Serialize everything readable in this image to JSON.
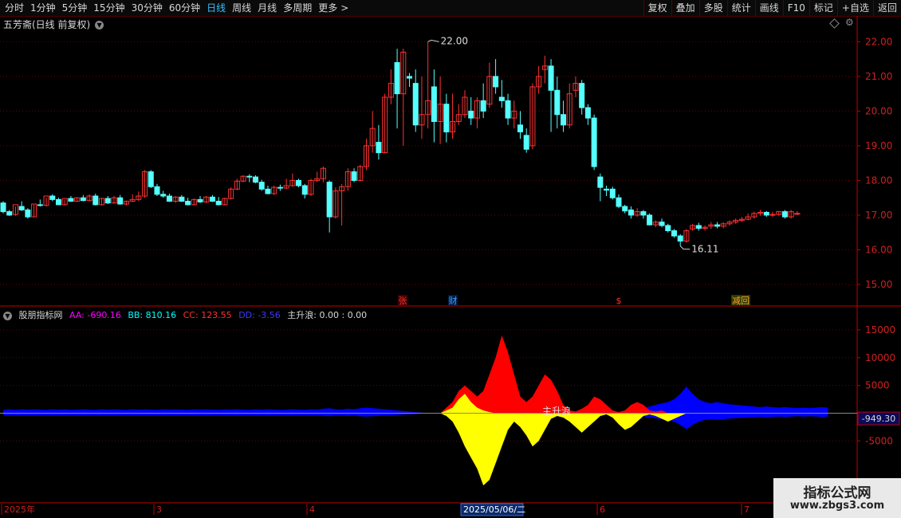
{
  "toolbar": {
    "periods": [
      "分时",
      "1分钟",
      "5分钟",
      "15分钟",
      "30分钟",
      "60分钟",
      "日线",
      "周线",
      "月线",
      "多周期",
      "更多"
    ],
    "active_period": "日线",
    "more_arrow": ">",
    "right_buttons": [
      "复权",
      "叠加",
      "多股",
      "统计",
      "画线",
      "F10",
      "标记",
      "+自选",
      "返回"
    ]
  },
  "main_chart": {
    "title": "五芳斋(日线 前复权)",
    "high_label": "22.00",
    "low_label": "16.11",
    "price_ticks": [
      "22.00",
      "21.00",
      "20.00",
      "19.00",
      "18.00",
      "17.00",
      "16.00",
      "15.00"
    ],
    "event_markers": [
      "张",
      "财",
      "$",
      "减回"
    ]
  },
  "indicator": {
    "name": "股朋指标网",
    "AA": "AA: -690.16",
    "BB": "BB: 810.16",
    "CC": "CC: 123.55",
    "DD": "DD: -3.56",
    "zsl": "主升浪: 0.00 : 0.00",
    "annotation": "主升浪",
    "ticks": [
      "15000",
      "10000",
      "5000",
      "-5000"
    ],
    "current_value": "-949.30"
  },
  "date_axis": {
    "labels": [
      "2025年",
      "3",
      "4",
      "2025/05/06/二",
      "6",
      "7"
    ]
  },
  "watermark": {
    "line1": "指标公式网",
    "line2": "www.zbgs3.com"
  },
  "colors": {
    "up": "#ff3232",
    "down": "#54ffff",
    "grid": "#6a0000",
    "aa": "#ff00ff",
    "bb": "#00ffff",
    "cc": "#ff3232",
    "dd": "#3a3aff",
    "yellow": "#ffff00",
    "red_area": "#ff0000",
    "blue_area": "#0000ff"
  },
  "chart_data": {
    "type": "candlestick",
    "ylim": [
      14.7,
      22.4
    ],
    "candles": [
      [
        17.35,
        17.4,
        17.1,
        17.05
      ],
      [
        17.1,
        17.15,
        17.0,
        16.98
      ],
      [
        17.02,
        17.25,
        17.3,
        16.98
      ],
      [
        17.25,
        17.4,
        17.15,
        17.12
      ],
      [
        17.15,
        17.2,
        16.95,
        16.9
      ],
      [
        16.95,
        17.3,
        17.32,
        16.95
      ],
      [
        17.3,
        17.45,
        17.28,
        17.25
      ],
      [
        17.28,
        17.5,
        17.55,
        17.25
      ],
      [
        17.55,
        17.6,
        17.45,
        17.4
      ],
      [
        17.45,
        17.5,
        17.3,
        17.3
      ],
      [
        17.3,
        17.45,
        17.48,
        17.28
      ],
      [
        17.48,
        17.55,
        17.4,
        17.38
      ],
      [
        17.4,
        17.52,
        17.5,
        17.38
      ],
      [
        17.5,
        17.58,
        17.42,
        17.4
      ],
      [
        17.42,
        17.6,
        17.55,
        17.4
      ],
      [
        17.55,
        17.62,
        17.3,
        17.28
      ],
      [
        17.3,
        17.5,
        17.48,
        17.28
      ],
      [
        17.48,
        17.55,
        17.35,
        17.32
      ],
      [
        17.35,
        17.55,
        17.5,
        17.33
      ],
      [
        17.5,
        17.58,
        17.32,
        17.3
      ],
      [
        17.32,
        17.42,
        17.4,
        17.28
      ],
      [
        17.4,
        17.6,
        17.45,
        17.38
      ],
      [
        17.45,
        17.68,
        17.55,
        17.4
      ],
      [
        17.55,
        18.3,
        18.25,
        17.5
      ],
      [
        18.25,
        18.3,
        17.82,
        17.78
      ],
      [
        17.82,
        17.9,
        17.6,
        17.55
      ],
      [
        17.6,
        17.7,
        17.55,
        17.5
      ],
      [
        17.55,
        17.62,
        17.4,
        17.38
      ],
      [
        17.4,
        17.55,
        17.52,
        17.35
      ],
      [
        17.52,
        17.58,
        17.4,
        17.38
      ],
      [
        17.4,
        17.5,
        17.3,
        17.28
      ],
      [
        17.3,
        17.48,
        17.45,
        17.28
      ],
      [
        17.45,
        17.55,
        17.38,
        17.35
      ],
      [
        17.38,
        17.55,
        17.52,
        17.35
      ],
      [
        17.52,
        17.58,
        17.4,
        17.38
      ],
      [
        17.4,
        17.52,
        17.3,
        17.28
      ],
      [
        17.3,
        17.5,
        17.48,
        17.28
      ],
      [
        17.48,
        17.8,
        17.75,
        17.45
      ],
      [
        17.75,
        18.05,
        17.98,
        17.72
      ],
      [
        17.98,
        18.15,
        18.12,
        17.95
      ],
      [
        18.12,
        18.18,
        18.1,
        17.95
      ],
      [
        18.1,
        18.15,
        17.95,
        17.92
      ],
      [
        17.95,
        18.02,
        17.75,
        17.7
      ],
      [
        17.75,
        17.85,
        17.62,
        17.6
      ],
      [
        17.62,
        17.85,
        17.8,
        17.58
      ],
      [
        17.8,
        17.88,
        17.78,
        17.7
      ],
      [
        17.78,
        18.05,
        17.85,
        17.75
      ],
      [
        17.85,
        18.2,
        18.0,
        17.82
      ],
      [
        18.0,
        18.05,
        17.85,
        17.8
      ],
      [
        17.85,
        17.9,
        17.6,
        17.48
      ],
      [
        17.6,
        18.05,
        18.0,
        17.55
      ],
      [
        18.0,
        18.25,
        18.05,
        17.95
      ],
      [
        18.05,
        18.4,
        18.35,
        17.95
      ],
      [
        17.95,
        18.0,
        16.95,
        16.5
      ],
      [
        16.95,
        17.8,
        17.7,
        16.9
      ],
      [
        17.7,
        17.9,
        17.82,
        16.7
      ],
      [
        17.82,
        18.35,
        18.25,
        17.7
      ],
      [
        18.25,
        18.35,
        18.0,
        17.95
      ],
      [
        18.0,
        18.45,
        18.4,
        17.98
      ],
      [
        18.4,
        19.2,
        19.0,
        18.3
      ],
      [
        19.0,
        20.0,
        19.5,
        18.8
      ],
      [
        19.1,
        19.6,
        18.8,
        18.6
      ],
      [
        18.8,
        20.5,
        20.4,
        18.8
      ],
      [
        20.4,
        21.2,
        20.8,
        20.2
      ],
      [
        21.4,
        21.8,
        20.5,
        19.5
      ],
      [
        20.5,
        21.8,
        21.7,
        19.0
      ],
      [
        21.0,
        21.1,
        20.95,
        20.7
      ],
      [
        20.8,
        21.2,
        19.6,
        19.4
      ],
      [
        19.6,
        21.0,
        19.9,
        19.2
      ],
      [
        19.9,
        22.0,
        20.3,
        19.5
      ],
      [
        20.7,
        21.2,
        19.7,
        19.1
      ],
      [
        19.7,
        21.0,
        20.2,
        19.05
      ],
      [
        20.2,
        20.5,
        19.4,
        19.1
      ],
      [
        19.4,
        20.5,
        19.7,
        19.2
      ],
      [
        19.7,
        20.2,
        19.9,
        19.6
      ],
      [
        19.9,
        20.6,
        20.4,
        19.8
      ],
      [
        20.0,
        20.4,
        19.8,
        19.6
      ],
      [
        19.8,
        20.4,
        20.3,
        19.5
      ],
      [
        20.3,
        20.8,
        20.0,
        19.8
      ],
      [
        20.2,
        21.4,
        21.0,
        20.1
      ],
      [
        21.0,
        21.5,
        20.7,
        20.5
      ],
      [
        20.4,
        20.9,
        20.3,
        20.1
      ],
      [
        20.3,
        20.5,
        19.8,
        19.6
      ],
      [
        19.8,
        20.3,
        20.0,
        19.5
      ],
      [
        19.6,
        20.0,
        19.4,
        19.2
      ],
      [
        19.3,
        19.5,
        18.9,
        18.8
      ],
      [
        19.0,
        20.8,
        20.7,
        18.9
      ],
      [
        20.7,
        21.3,
        21.0,
        20.5
      ],
      [
        21.2,
        21.6,
        21.3,
        20.8
      ],
      [
        21.3,
        21.5,
        20.6,
        19.4
      ],
      [
        20.6,
        21.0,
        19.9,
        19.5
      ],
      [
        19.9,
        20.3,
        19.6,
        19.4
      ],
      [
        19.6,
        20.8,
        20.5,
        19.5
      ],
      [
        20.6,
        21.0,
        20.8,
        20.4
      ],
      [
        20.8,
        20.9,
        20.1,
        19.9
      ],
      [
        20.1,
        20.2,
        19.8,
        19.6
      ],
      [
        19.8,
        19.9,
        18.4,
        18.3
      ],
      [
        18.1,
        18.2,
        17.8,
        17.4
      ],
      [
        17.75,
        17.85,
        17.72,
        17.55
      ],
      [
        17.75,
        17.82,
        17.5,
        17.45
      ],
      [
        17.5,
        17.6,
        17.25,
        17.2
      ],
      [
        17.25,
        17.3,
        17.12,
        17.05
      ],
      [
        17.15,
        17.25,
        17.0,
        16.9
      ],
      [
        17.0,
        17.2,
        17.1,
        16.95
      ],
      [
        17.1,
        17.15,
        17.0,
        16.9
      ],
      [
        17.0,
        17.05,
        16.72,
        16.7
      ],
      [
        16.72,
        16.85,
        16.8,
        16.65
      ],
      [
        16.8,
        16.9,
        16.7,
        16.65
      ],
      [
        16.7,
        16.75,
        16.55,
        16.5
      ],
      [
        16.55,
        16.6,
        16.4,
        16.35
      ],
      [
        16.4,
        16.45,
        16.25,
        16.11
      ],
      [
        16.25,
        16.6,
        16.55,
        16.2
      ],
      [
        16.6,
        16.75,
        16.7,
        16.55
      ],
      [
        16.7,
        16.78,
        16.62,
        16.55
      ],
      [
        16.62,
        16.7,
        16.65,
        16.55
      ],
      [
        16.68,
        16.8,
        16.72,
        16.6
      ],
      [
        16.72,
        16.8,
        16.68,
        16.62
      ],
      [
        16.68,
        16.8,
        16.75,
        16.62
      ],
      [
        16.75,
        16.85,
        16.8,
        16.7
      ],
      [
        16.8,
        16.9,
        16.85,
        16.75
      ],
      [
        16.85,
        16.95,
        16.88,
        16.8
      ],
      [
        16.88,
        17.05,
        16.95,
        16.85
      ],
      [
        16.95,
        17.1,
        17.05,
        16.9
      ],
      [
        17.05,
        17.15,
        17.08,
        16.98
      ],
      [
        17.08,
        17.12,
        17.0,
        16.95
      ],
      [
        17.0,
        17.1,
        17.02,
        16.95
      ],
      [
        17.02,
        17.12,
        17.1,
        16.98
      ],
      [
        17.1,
        17.15,
        16.95,
        16.9
      ],
      [
        16.95,
        17.15,
        17.1,
        16.9
      ],
      [
        17.05,
        17.12,
        17.05,
        17.0
      ]
    ],
    "indicator_areas": {
      "red_top": [
        0,
        0,
        0,
        0,
        0,
        0,
        0,
        0,
        0,
        0,
        0,
        0,
        0,
        0,
        0,
        0,
        0,
        0,
        0,
        0,
        0,
        0,
        0,
        0,
        0,
        0,
        0,
        0,
        0,
        0,
        0,
        0,
        0,
        0,
        0,
        0,
        0,
        0,
        0,
        0,
        0,
        0,
        0,
        0,
        0,
        0,
        0,
        0,
        0,
        0,
        0,
        0,
        0,
        0,
        0,
        0,
        0,
        0,
        0,
        0,
        0,
        0,
        0,
        0,
        0,
        0,
        0,
        0,
        0,
        0,
        0,
        0,
        1000,
        2000,
        4000,
        5000,
        4000,
        3000,
        4000,
        7000,
        10000,
        14000,
        11000,
        7000,
        3000,
        2000,
        3000,
        5000,
        7000,
        6000,
        4000,
        1500,
        500,
        300,
        800,
        1500,
        3000,
        2500,
        1500,
        500,
        200,
        500,
        1500,
        2000,
        1500,
        500,
        300,
        500,
        0,
        0,
        0,
        0,
        0,
        0,
        0,
        0,
        0,
        0,
        0,
        0,
        0,
        0,
        0,
        0,
        0,
        0,
        0,
        0,
        0,
        0,
        0,
        0,
        0,
        0,
        0,
        0
      ],
      "yellow_top": [
        0,
        0,
        0,
        0,
        0,
        0,
        0,
        0,
        0,
        0,
        0,
        0,
        0,
        0,
        0,
        0,
        0,
        0,
        0,
        0,
        0,
        0,
        0,
        0,
        0,
        0,
        0,
        0,
        0,
        0,
        0,
        0,
        0,
        0,
        0,
        0,
        0,
        0,
        0,
        0,
        0,
        0,
        0,
        0,
        0,
        0,
        0,
        0,
        0,
        0,
        0,
        0,
        0,
        0,
        0,
        0,
        0,
        0,
        0,
        0,
        0,
        0,
        0,
        0,
        0,
        0,
        0,
        0,
        0,
        0,
        0,
        0,
        500,
        1000,
        2500,
        3500,
        2000,
        1000,
        500,
        200,
        0,
        0,
        0,
        0,
        0,
        0,
        0,
        0,
        0,
        0,
        0,
        0,
        0,
        0,
        0,
        0,
        0,
        0,
        0,
        0,
        0,
        0,
        0,
        0,
        0,
        0,
        0,
        0,
        0,
        0,
        0,
        0,
        0,
        0,
        0,
        0,
        0,
        0,
        0,
        0,
        0,
        0,
        0,
        0,
        0,
        0,
        0,
        0,
        0,
        0,
        0,
        0,
        0,
        0,
        0,
        0
      ],
      "yellow_bottom": [
        0,
        0,
        0,
        0,
        0,
        0,
        0,
        0,
        0,
        0,
        0,
        0,
        0,
        0,
        0,
        0,
        0,
        0,
        0,
        0,
        0,
        0,
        0,
        0,
        0,
        0,
        0,
        0,
        0,
        0,
        0,
        0,
        0,
        0,
        0,
        0,
        0,
        0,
        0,
        0,
        0,
        0,
        0,
        0,
        0,
        0,
        0,
        0,
        0,
        0,
        0,
        0,
        0,
        0,
        0,
        0,
        0,
        0,
        0,
        0,
        0,
        0,
        0,
        0,
        0,
        0,
        0,
        0,
        0,
        0,
        0,
        0,
        -500,
        -1500,
        -3500,
        -6000,
        -8000,
        -10000,
        -13000,
        -12000,
        -9000,
        -6000,
        -3000,
        -1500,
        -2500,
        -4000,
        -6000,
        -5000,
        -3000,
        -1000,
        -500,
        -800,
        -1500,
        -2500,
        -3500,
        -2500,
        -1500,
        -500,
        -200,
        -800,
        -2000,
        -3000,
        -2500,
        -1500,
        -500,
        -200,
        -500,
        -1000,
        -1500,
        -1000,
        -500,
        0,
        0,
        0,
        0,
        0,
        0,
        0,
        0,
        0,
        0,
        0,
        0,
        0,
        0,
        0,
        0,
        0,
        0,
        0,
        0,
        0,
        0,
        0,
        0
      ],
      "blue_band": [
        600,
        700,
        600,
        700,
        650,
        700,
        650,
        600,
        700,
        650,
        700,
        600,
        650,
        700,
        650,
        600,
        700,
        650,
        700,
        650,
        600,
        700,
        650,
        700,
        650,
        600,
        700,
        650,
        700,
        650,
        600,
        700,
        650,
        700,
        650,
        600,
        700,
        650,
        700,
        650,
        600,
        700,
        650,
        700,
        650,
        600,
        650,
        700,
        650,
        600,
        700,
        650,
        800,
        900,
        700,
        650,
        800,
        700,
        900,
        1000,
        900,
        800,
        700,
        600,
        500,
        400,
        300,
        200,
        100,
        0,
        0,
        0,
        0,
        0,
        0,
        0,
        0,
        0,
        0,
        0,
        0,
        0,
        0,
        0,
        0,
        0,
        0,
        0,
        0,
        0,
        0,
        0,
        0,
        0,
        0,
        0,
        0,
        0,
        0,
        0,
        0,
        0,
        0,
        500,
        1000,
        1200,
        1500,
        1800,
        2000,
        2500,
        3500,
        4800,
        3500,
        2500,
        2000,
        1800,
        2000,
        1800,
        1600,
        1500,
        1400,
        1300,
        1200,
        1100,
        1200,
        1100,
        1000,
        1100,
        1000,
        900,
        1000,
        900,
        1000,
        1100,
        1000
      ]
    }
  }
}
